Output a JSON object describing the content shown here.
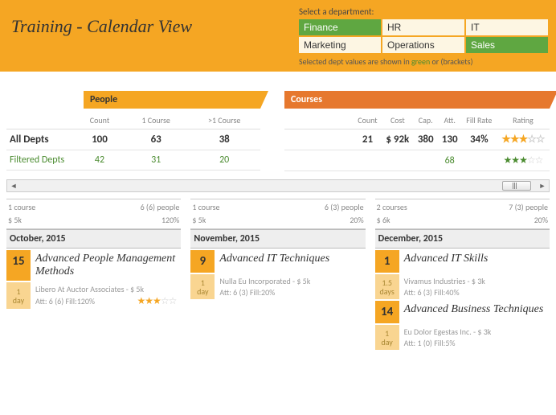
{
  "header": {
    "title": "Training - Calendar View",
    "dept_label": "Select a department:",
    "departments": [
      "Finance",
      "HR",
      "IT",
      "Marketing",
      "Operations",
      "Sales"
    ],
    "selected": [
      "Finance",
      "Sales"
    ],
    "note_a": "Selected dept values are shown in ",
    "note_green": "green",
    "note_b": " or (brackets)"
  },
  "people": {
    "tab": "People",
    "cols": [
      "Count",
      "1 Course",
      ">1 Course"
    ],
    "row_all_label": "All Depts",
    "all": [
      "100",
      "63",
      "38"
    ],
    "row_filt_label": "Filtered Depts",
    "filt": [
      "42",
      "31",
      "20"
    ]
  },
  "courses": {
    "tab": "Courses",
    "cols": [
      "Count",
      "Cost",
      "Cap.",
      "Att.",
      "Fill Rate",
      "Rating"
    ],
    "all": [
      "21",
      "$ 92k",
      "380",
      "130",
      "34%"
    ],
    "rating_all": "★★★☆☆",
    "filt_att": "68",
    "rating_filt": "★★★☆☆"
  },
  "months": [
    {
      "summary": {
        "courses": "1 course",
        "people": "6 (6) people",
        "cost": "$ 5k",
        "pct": "120%"
      },
      "header": "October, 2015",
      "items": [
        {
          "date": "15",
          "title": "Advanced People Management Methods",
          "dur_n": "1",
          "dur_u": "day",
          "vendor": "Libero At Auctor Associates - $ 5k",
          "stats": "Att: 6 (6) Fill:120%",
          "stars": "★★★☆☆"
        }
      ]
    },
    {
      "summary": {
        "courses": "1 course",
        "people": "6 (3) people",
        "cost": "$ 5k",
        "pct": "20%"
      },
      "header": "November, 2015",
      "items": [
        {
          "date": "9",
          "title": "Advanced IT Techniques",
          "dur_n": "1",
          "dur_u": "day",
          "vendor": "Nulla Eu Incorporated - $ 5k",
          "stats": "Att: 6 (3) Fill:20%",
          "stars": ""
        }
      ]
    },
    {
      "summary": {
        "courses": "2 courses",
        "people": "7 (3) people",
        "cost": "$ 6k",
        "pct": "20%"
      },
      "header": "December, 2015",
      "items": [
        {
          "date": "1",
          "title": "Advanced IT Skills",
          "dur_n": "1.5",
          "dur_u": "days",
          "vendor": "Vivamus Industries - $ 3k",
          "stats": "Att: 6 (3) Fill:40%",
          "stars": ""
        },
        {
          "date": "14",
          "title": "Advanced Business Techniques",
          "dur_n": "1",
          "dur_u": "day",
          "vendor": "Eu Dolor Egestas Inc. - $ 3k",
          "stats": "Att: 1 (0) Fill:5%",
          "stars": ""
        }
      ]
    }
  ]
}
